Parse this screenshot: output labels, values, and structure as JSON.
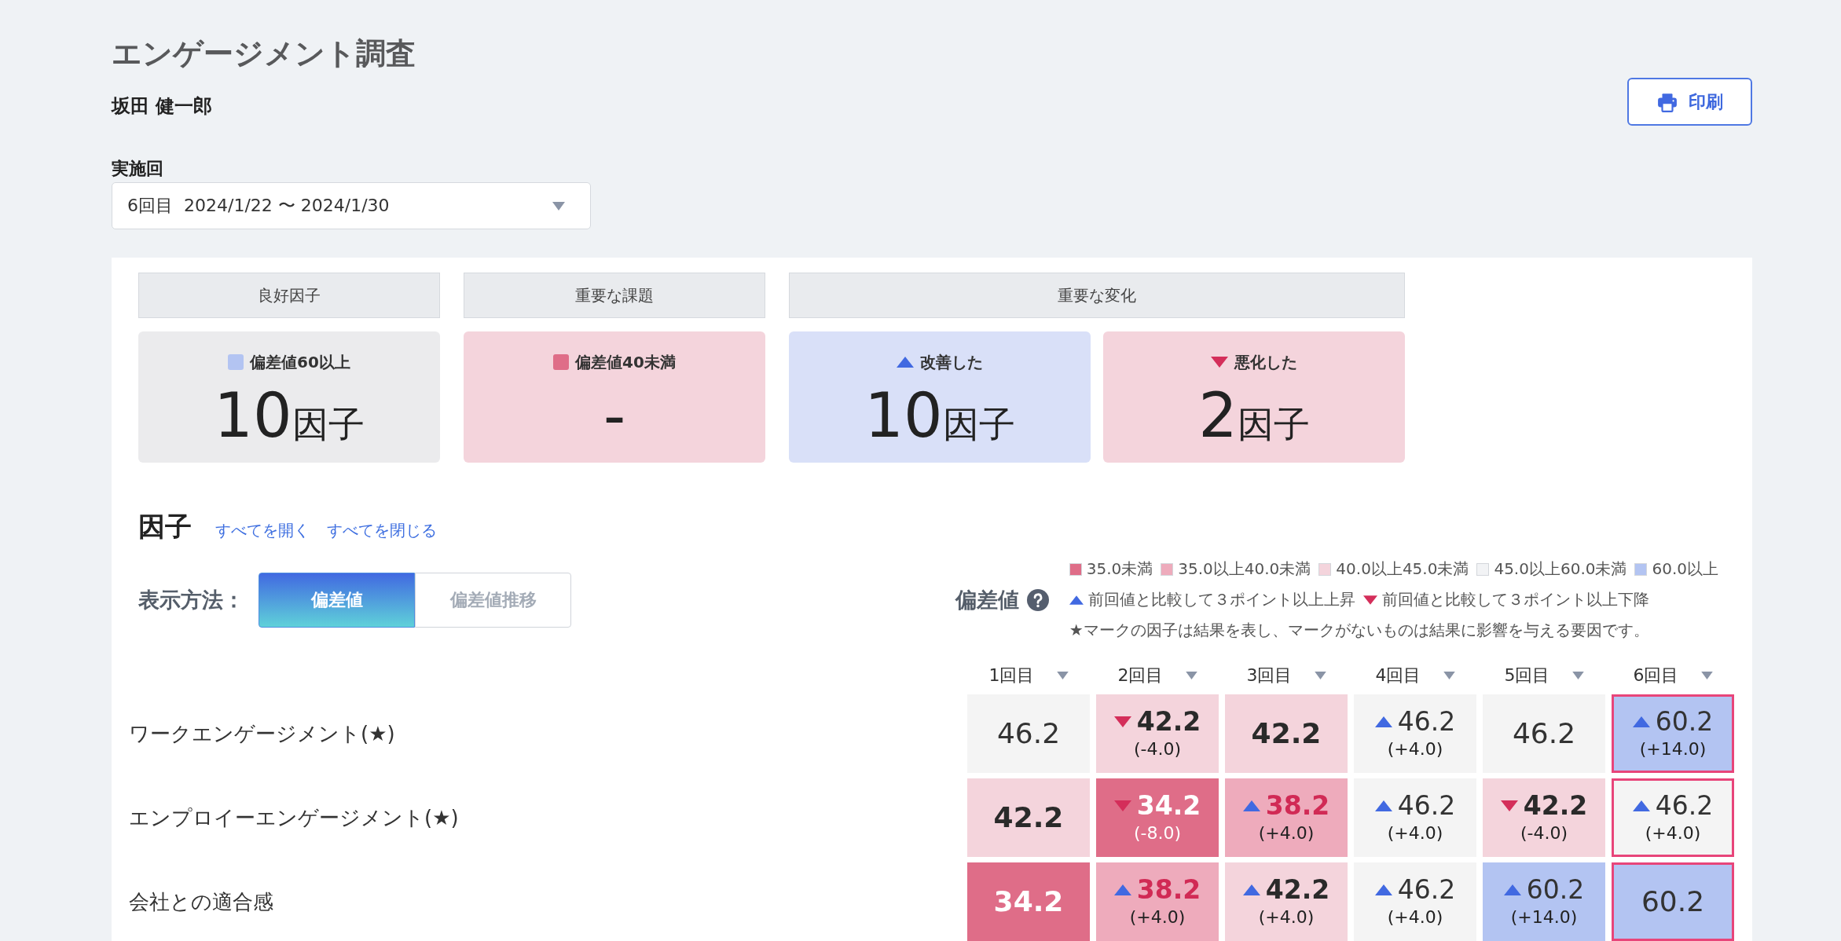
{
  "header": {
    "title": "エンゲージメント調査",
    "person": "坂田 健一郎",
    "print_button": "印刷"
  },
  "round_select": {
    "label": "実施回",
    "value": "6回目  2024/1/22 〜 2024/1/30"
  },
  "summary": [
    {
      "header": "良好因子",
      "cards": [
        {
          "kind": "good",
          "color": "#b3c4f2",
          "label": "偏差値60以上",
          "count": "10",
          "unit": "因子"
        }
      ]
    },
    {
      "header": "重要な課題",
      "cards": [
        {
          "kind": "issue",
          "color": "#df6d88",
          "label": "偏差値40未満",
          "count": "-"
        }
      ]
    },
    {
      "header": "重要な変化",
      "cards": [
        {
          "kind": "improved",
          "color": "#4169e1",
          "label": "改善した",
          "count": "10",
          "unit": "因子"
        },
        {
          "kind": "worsened",
          "color": "#d42e5a",
          "label": "悪化した",
          "count": "2",
          "unit": "因子"
        }
      ]
    }
  ],
  "factors": {
    "heading": "因子",
    "links": [
      "すべてを開く",
      "すべてを閉じる"
    ],
    "view_label": "表示方法：",
    "view_options": [
      {
        "label": "偏差値",
        "selected": true
      },
      {
        "label": "偏差値推移",
        "selected": false
      }
    ]
  },
  "legend": {
    "title": "偏差値",
    "bands": [
      {
        "label": "35.0未満",
        "color": "#df6d88"
      },
      {
        "label": "35.0以上40.0未満",
        "color": "#eeabbc"
      },
      {
        "label": "40.0以上45.0未満",
        "color": "#f4d4dc"
      },
      {
        "label": "45.0以上60.0未満",
        "color": "#f2f3f5"
      },
      {
        "label": "60.0以上",
        "color": "#b3c4f2"
      }
    ],
    "trends": [
      {
        "kind": "rise",
        "color": "#4169e1",
        "label": "前回値と比較して３ポイント以上上昇"
      },
      {
        "kind": "fall",
        "color": "#d42e5a",
        "label": "前回値と比較して３ポイント以上下降"
      }
    ],
    "note": "★マークの因子は結果を表し、マークがないものは結果に影響を与える要因です。"
  },
  "table": {
    "columns": [
      {
        "label": "1回目",
        "selected": false
      },
      {
        "label": "2回目",
        "selected": false
      },
      {
        "label": "3回目",
        "selected": false
      },
      {
        "label": "4回目",
        "selected": false
      },
      {
        "label": "5回目",
        "selected": false
      },
      {
        "label": "6回目",
        "selected": true
      }
    ],
    "rows": [
      {
        "name": "ワークエンゲージメント(★)",
        "cells": [
          {
            "value": "46.2",
            "color": "#f4f4f4",
            "improved": false,
            "worsened": false
          },
          {
            "value": "42.2",
            "change": "(-4.0)",
            "color": "#f4d4dc",
            "improved": false,
            "worsened": true
          },
          {
            "value": "42.2",
            "color": "#f4d4dc",
            "improved": false,
            "worsened": false
          },
          {
            "value": "46.2",
            "change": "(+4.0)",
            "color": "#f4f4f4",
            "improved": true,
            "worsened": false
          },
          {
            "value": "46.2",
            "color": "#f4f4f4",
            "improved": false,
            "worsened": false
          },
          {
            "value": "60.2",
            "change": "(+14.0)",
            "color": "#b3c4f2",
            "improved": true,
            "worsened": false
          }
        ]
      },
      {
        "name": "エンプロイーエンゲージメント(★)",
        "cells": [
          {
            "value": "42.2",
            "color": "#f4d4dc",
            "improved": false,
            "worsened": false
          },
          {
            "value": "34.2",
            "change": "(-8.0)",
            "color": "#df6d88",
            "improved": false,
            "worsened": true
          },
          {
            "value": "38.2",
            "change": "(+4.0)",
            "color": "#eeabbc",
            "improved": true,
            "worsened": false
          },
          {
            "value": "46.2",
            "change": "(+4.0)",
            "color": "#f4f4f4",
            "improved": true,
            "worsened": false
          },
          {
            "value": "42.2",
            "change": "(-4.0)",
            "color": "#f4d4dc",
            "improved": false,
            "worsened": true
          },
          {
            "value": "46.2",
            "change": "(+4.0)",
            "color": "#f4f4f4",
            "improved": true,
            "worsened": false
          }
        ]
      },
      {
        "name": "会社との適合感",
        "cells": [
          {
            "value": "34.2",
            "color": "#df6d88",
            "improved": false,
            "worsened": false
          },
          {
            "value": "38.2",
            "change": "(+4.0)",
            "color": "#eeabbc",
            "improved": true,
            "worsened": false
          },
          {
            "value": "42.2",
            "change": "(+4.0)",
            "color": "#f4d4dc",
            "improved": true,
            "worsened": false
          },
          {
            "value": "46.2",
            "change": "(+4.0)",
            "color": "#f4f4f4",
            "improved": true,
            "worsened": false
          },
          {
            "value": "60.2",
            "change": "(+14.0)",
            "color": "#b3c4f2",
            "improved": true,
            "worsened": false
          },
          {
            "value": "60.2",
            "color": "#b3c4f2",
            "improved": false,
            "worsened": false
          }
        ]
      }
    ]
  }
}
